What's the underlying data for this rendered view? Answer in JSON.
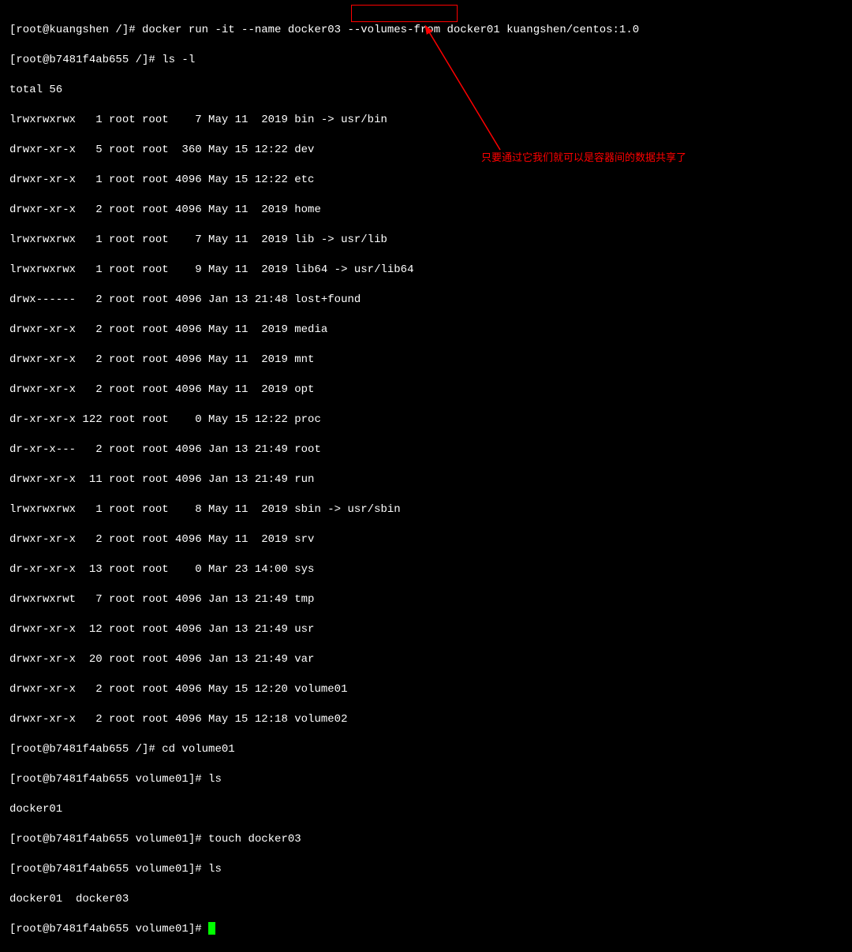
{
  "line1": "[root@kuangshen /]# docker run -it --name docker03 --volumes-from docker01 kuangshen/centos:1.0",
  "line2": "[root@b7481f4ab655 /]# ls -l",
  "line3": "total 56",
  "ls_rows": [
    "lrwxrwxrwx   1 root root    7 May 11  2019 bin -> usr/bin",
    "drwxr-xr-x   5 root root  360 May 15 12:22 dev",
    "drwxr-xr-x   1 root root 4096 May 15 12:22 etc",
    "drwxr-xr-x   2 root root 4096 May 11  2019 home",
    "lrwxrwxrwx   1 root root    7 May 11  2019 lib -> usr/lib",
    "lrwxrwxrwx   1 root root    9 May 11  2019 lib64 -> usr/lib64",
    "drwx------   2 root root 4096 Jan 13 21:48 lost+found",
    "drwxr-xr-x   2 root root 4096 May 11  2019 media",
    "drwxr-xr-x   2 root root 4096 May 11  2019 mnt",
    "drwxr-xr-x   2 root root 4096 May 11  2019 opt",
    "dr-xr-xr-x 122 root root    0 May 15 12:22 proc",
    "dr-xr-x---   2 root root 4096 Jan 13 21:49 root",
    "drwxr-xr-x  11 root root 4096 Jan 13 21:49 run",
    "lrwxrwxrwx   1 root root    8 May 11  2019 sbin -> usr/sbin",
    "drwxr-xr-x   2 root root 4096 May 11  2019 srv",
    "dr-xr-xr-x  13 root root    0 Mar 23 14:00 sys",
    "drwxrwxrwt   7 root root 4096 Jan 13 21:49 tmp",
    "drwxr-xr-x  12 root root 4096 Jan 13 21:49 usr",
    "drwxr-xr-x  20 root root 4096 Jan 13 21:49 var",
    "drwxr-xr-x   2 root root 4096 May 15 12:20 volume01",
    "drwxr-xr-x   2 root root 4096 May 15 12:18 volume02"
  ],
  "line_cd": "[root@b7481f4ab655 /]# cd volume01",
  "line_ls1": "[root@b7481f4ab655 volume01]# ls",
  "line_ls1_out": "docker01",
  "line_touch": "[root@b7481f4ab655 volume01]# touch docker03",
  "line_ls2": "[root@b7481f4ab655 volume01]# ls",
  "line_ls2_out": "docker01  docker03",
  "line_prompt": "[root@b7481f4ab655 volume01]# ",
  "annotation_text": "只要通过它我们就可以是容器间的数据共享了"
}
